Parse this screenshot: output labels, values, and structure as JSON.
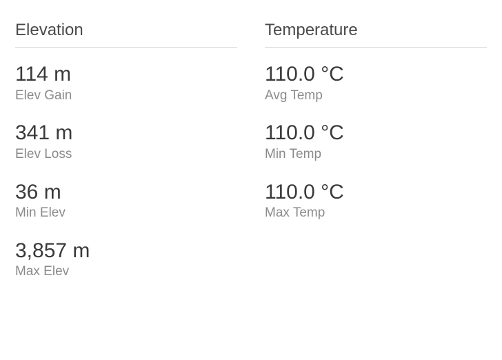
{
  "elevation": {
    "header": "Elevation",
    "stats": [
      {
        "value": "114 m",
        "label": "Elev Gain"
      },
      {
        "value": "341 m",
        "label": "Elev Loss"
      },
      {
        "value": "36 m",
        "label": "Min Elev"
      },
      {
        "value": "3,857 m",
        "label": "Max Elev"
      }
    ]
  },
  "temperature": {
    "header": "Temperature",
    "stats": [
      {
        "value": "110.0 °C",
        "label": "Avg Temp"
      },
      {
        "value": "110.0 °C",
        "label": "Min Temp"
      },
      {
        "value": "110.0 °C",
        "label": "Max Temp"
      }
    ]
  }
}
